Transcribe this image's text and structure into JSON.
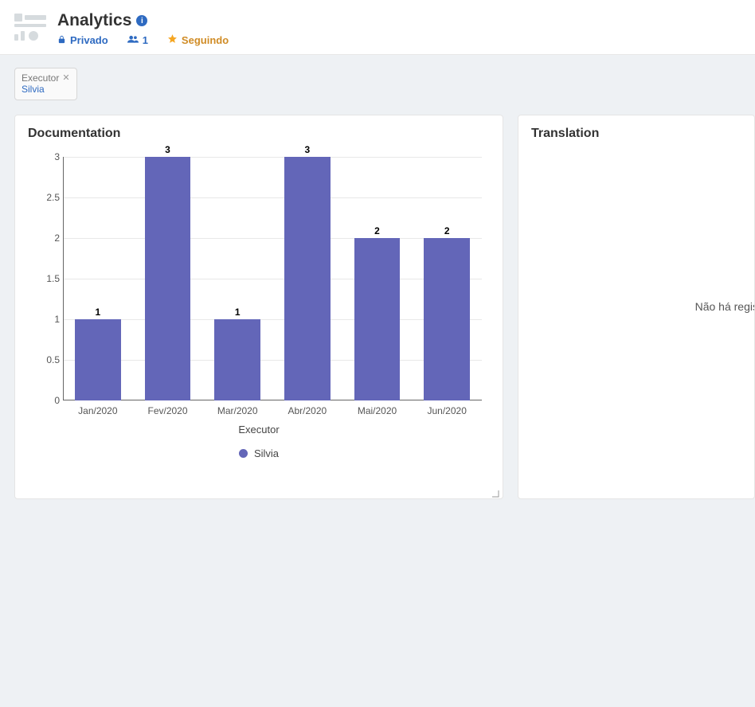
{
  "header": {
    "title": "Analytics",
    "privacy_label": "Privado",
    "user_count": "1",
    "follow_label": "Seguindo"
  },
  "filter": {
    "field": "Executor",
    "value": "Silvia"
  },
  "panels": {
    "documentation": {
      "title": "Documentation"
    },
    "translation": {
      "title": "Translation",
      "empty_message": "Não há registros p"
    }
  },
  "chart_data": {
    "type": "bar",
    "title": "Documentation",
    "categories": [
      "Jan/2020",
      "Fev/2020",
      "Mar/2020",
      "Abr/2020",
      "Mai/2020",
      "Jun/2020"
    ],
    "values": [
      1,
      3,
      1,
      3,
      2,
      2
    ],
    "xlabel": "Executor",
    "ylabel": "",
    "ylim": [
      0,
      3
    ],
    "y_ticks": [
      0,
      0.5,
      1,
      1.5,
      2,
      2.5,
      3
    ],
    "legend": [
      "Silvia"
    ],
    "series_color": "#6366b8"
  }
}
